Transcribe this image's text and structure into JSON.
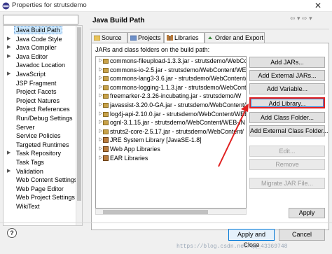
{
  "window": {
    "title": "Properties for strutsdemo",
    "close_glyph": "✕"
  },
  "nav": {
    "items": [
      {
        "label": "Java Build Path",
        "arrow": "",
        "selected": true
      },
      {
        "label": "Java Code Style",
        "arrow": "▶"
      },
      {
        "label": "Java Compiler",
        "arrow": "▶"
      },
      {
        "label": "Java Editor",
        "arrow": "▶"
      },
      {
        "label": "Javadoc Location",
        "arrow": ""
      },
      {
        "label": "JavaScript",
        "arrow": "▶"
      },
      {
        "label": "JSP Fragment",
        "arrow": ""
      },
      {
        "label": "Project Facets",
        "arrow": ""
      },
      {
        "label": "Project Natures",
        "arrow": ""
      },
      {
        "label": "Project References",
        "arrow": ""
      },
      {
        "label": "Run/Debug Settings",
        "arrow": ""
      },
      {
        "label": "Server",
        "arrow": ""
      },
      {
        "label": "Service Policies",
        "arrow": ""
      },
      {
        "label": "Targeted Runtimes",
        "arrow": ""
      },
      {
        "label": "Task Repository",
        "arrow": "▶"
      },
      {
        "label": "Task Tags",
        "arrow": ""
      },
      {
        "label": "Validation",
        "arrow": "▶"
      },
      {
        "label": "Web Content Settings",
        "arrow": ""
      },
      {
        "label": "Web Page Editor",
        "arrow": ""
      },
      {
        "label": "Web Project Settings",
        "arrow": ""
      },
      {
        "label": "WikiText",
        "arrow": ""
      }
    ]
  },
  "page": {
    "title": "Java Build Path",
    "back_label": "⇦ ▾ ⇨ ▾"
  },
  "tabs": [
    {
      "label": "Source",
      "active": false
    },
    {
      "label": "Projects",
      "active": false
    },
    {
      "label": "Libraries",
      "active": true
    },
    {
      "label": "Order and Export",
      "active": false
    }
  ],
  "libraries": {
    "heading": "JARs and class folders on the build path:",
    "rows": [
      {
        "label": "commons-fileupload-1.3.3.jar - strutsdemo/WebCont",
        "kind": "jar"
      },
      {
        "label": "commons-io-2.5.jar - strutsdemo/WebContent/WE",
        "kind": "jar"
      },
      {
        "label": "commons-lang3-3.6.jar - strutsdemo/WebContent/W",
        "kind": "jar"
      },
      {
        "label": "commons-logging-1.1.3.jar - strutsdemo/WebConte",
        "kind": "jar"
      },
      {
        "label": "freemarker-2.3.26-incubating.jar - strutsdemo/W",
        "kind": "jar"
      },
      {
        "label": "javassist-3.20.0-GA.jar - strutsdemo/WebContent/W",
        "kind": "jar"
      },
      {
        "label": "log4j-api-2.10.0.jar - strutsdemo/WebContent/WEB",
        "kind": "jar"
      },
      {
        "label": "ognl-3.1.15.jar - strutsdemo/WebContent/WEB-IN",
        "kind": "jar"
      },
      {
        "label": "struts2-core-2.5.17.jar - strutsdemo/WebContent/",
        "kind": "jar"
      },
      {
        "label": "JRE System Library [JavaSE-1.8]",
        "kind": "lib"
      },
      {
        "label": "Web App Libraries",
        "kind": "lib"
      },
      {
        "label": "EAR Libraries",
        "kind": "lib"
      }
    ]
  },
  "buttons": {
    "add_jars": "Add JARs...",
    "add_external_jars": "Add External JARs...",
    "add_variable": "Add Variable...",
    "add_library": "Add Library...",
    "add_class_folder": "Add Class Folder...",
    "add_external_class_folder": "Add External Class Folder...",
    "edit": "Edit...",
    "remove": "Remove",
    "migrate_jar": "Migrate JAR File...",
    "apply": "Apply",
    "apply_and_close": "Apply and Close",
    "cancel": "Cancel",
    "help": "?"
  },
  "watermark": "https://blog.csdn.net/qq_43369748",
  "colors": {
    "highlight_border": "#e02020",
    "selection_bg": "#cce8ff",
    "primary_button_border": "#0078d7"
  }
}
